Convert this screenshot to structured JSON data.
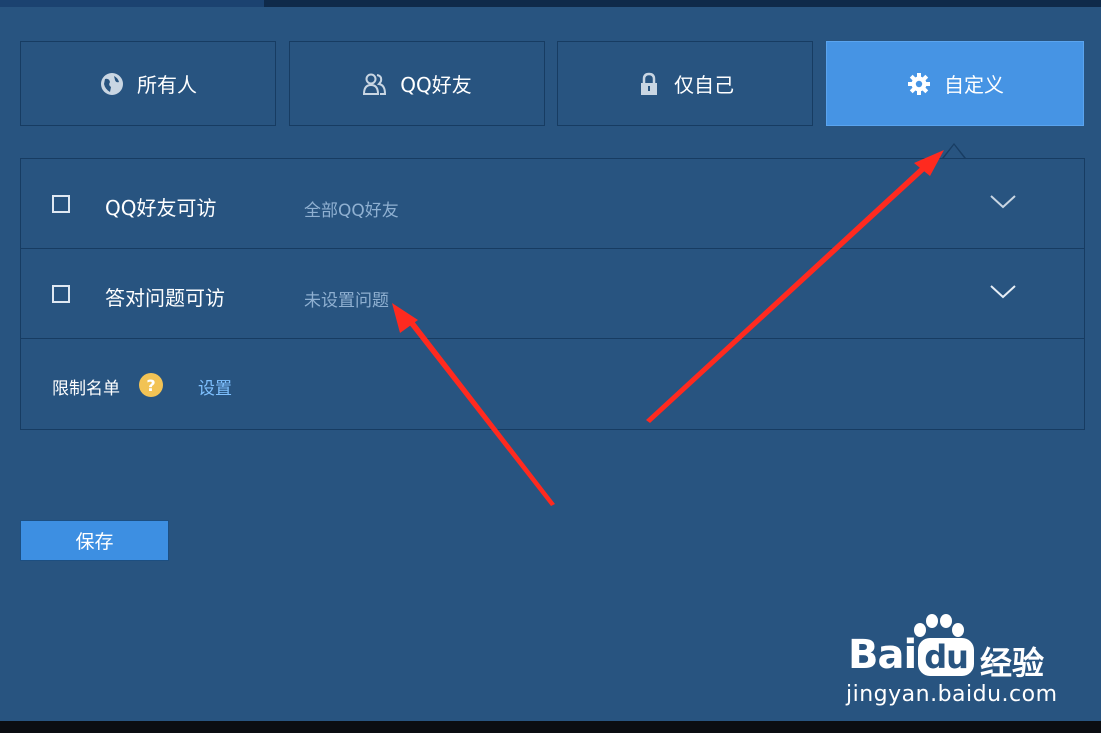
{
  "tabs": [
    {
      "label": "所有人",
      "icon": "globe-icon",
      "active": false
    },
    {
      "label": "QQ好友",
      "icon": "friends-icon",
      "active": false
    },
    {
      "label": "仅自己",
      "icon": "lock-icon",
      "active": false
    },
    {
      "label": "自定义",
      "icon": "gear-icon",
      "active": true
    }
  ],
  "options": [
    {
      "label": "QQ好友可访",
      "value": "全部QQ好友",
      "checked": false
    },
    {
      "label": "答对问题可访",
      "value": "未设置问题",
      "checked": false
    }
  ],
  "limit": {
    "label": "限制名单",
    "help_glyph": "?",
    "link": "设置"
  },
  "save_label": "保存",
  "watermark": {
    "logo_left": "Bai",
    "logo_du": "du",
    "logo_cn": "经验",
    "url": "jingyan.baidu.com"
  },
  "colors": {
    "background": "#285480",
    "active_tab": "#4694e4",
    "save_button": "#3d8fe2",
    "link": "#7fc1ff",
    "help": "#f2c355",
    "annotation_arrow": "#ff2a1f"
  }
}
